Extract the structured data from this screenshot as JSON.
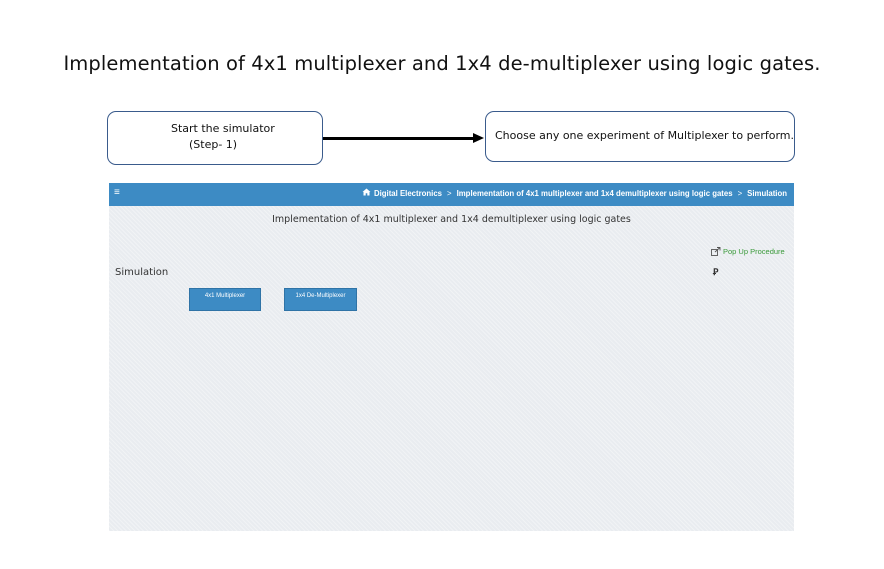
{
  "main_title": "Implementation of 4x1 multiplexer and 1x4 de-multiplexer using logic gates.",
  "callouts": {
    "step1_line1": "Start the simulator",
    "step1_line2": "(Step- 1)",
    "step2": "Choose any one experiment of Multiplexer to perform."
  },
  "simulator": {
    "navbar": {
      "menu_icon": "hamburger-icon",
      "home_icon": "home-icon",
      "breadcrumb": [
        "Digital Electronics",
        "Implementation of 4x1 multiplexer and 1x4 demultiplexer using logic gates",
        "Simulation"
      ],
      "separator": ">"
    },
    "title": "Implementation of 4x1 multiplexer and 1x4 demultiplexer using logic gates",
    "popup_link": "Pop Up Procedure",
    "section_label": "Simulation",
    "buttons": [
      "4x1 Multiplexer",
      "1x4 De-Multiplexer"
    ],
    "colors": {
      "accent": "#3d8bc4",
      "link_green": "#3a9a3a",
      "panel_bg": "#e9ecf0"
    }
  }
}
